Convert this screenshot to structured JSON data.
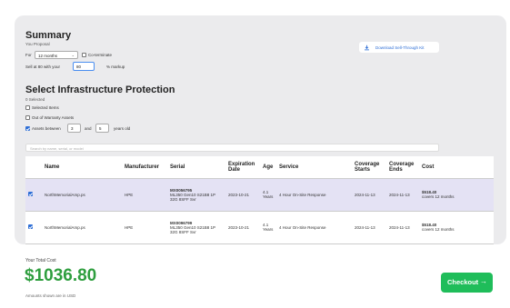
{
  "summary": {
    "title": "Summary",
    "subtitle": "You Proposal",
    "for_label": "For",
    "term_value": "12 months",
    "coterminate_label": "Co-terminate",
    "sell_label": "Sell at 80 with your",
    "markup_value": "80",
    "markup_suffix": "% markup",
    "download_label": "Download Sell-Through Kit"
  },
  "protection": {
    "title": "Select Infrastructure Protection",
    "selected_count": "0 Selected",
    "option_selected": "Selected Items",
    "option_out_of_warranty": "Out of Warranty Assets",
    "option_assets_between": "Assets between",
    "years_from": "3",
    "and_label": "and",
    "years_to": "5",
    "years_old_label": "years old",
    "search_placeholder": "Search by name, serial, or model"
  },
  "table": {
    "headers": [
      "Name",
      "Manufacturer",
      "Serial",
      "Expiration Date",
      "Age",
      "Service",
      "Coverage Starts",
      "Coverage Ends",
      "Cost"
    ],
    "rows": [
      {
        "checked": true,
        "name": "NorthMemorialAmp.ps",
        "manufacturer": "HPE",
        "serial": "MX0056795",
        "serial_desc": "ML350 Gen10 S21B8 1P 32G 8SFF Svr",
        "expiration": "2023-10-21",
        "age": "4.1 Years",
        "service": "4 Hour On-Site Response",
        "coverage_start": "2024-11-13",
        "coverage_end": "2024-11-13",
        "cost": "$518.40",
        "cost_note": "covers 12 months"
      },
      {
        "checked": true,
        "name": "NorthMemorialAmp.ps",
        "manufacturer": "HPE",
        "serial": "MX0096799",
        "serial_desc": "ML350 Gen10 S21B8 1P 32G 8SFF Svr",
        "expiration": "2023-10-21",
        "age": "4.1 Years",
        "service": "4 Hour On-Site Response",
        "coverage_start": "2024-11-13",
        "coverage_end": "2024-11-13",
        "cost": "$518.40",
        "cost_note": "covers 12 months"
      }
    ]
  },
  "footer": {
    "total_label": "Your Total Cost",
    "total_value": "$1036.80",
    "currency_note": "Amounts shown are in USD",
    "checkout_label": "Checkout",
    "accent_color": "#1fbd5a"
  }
}
